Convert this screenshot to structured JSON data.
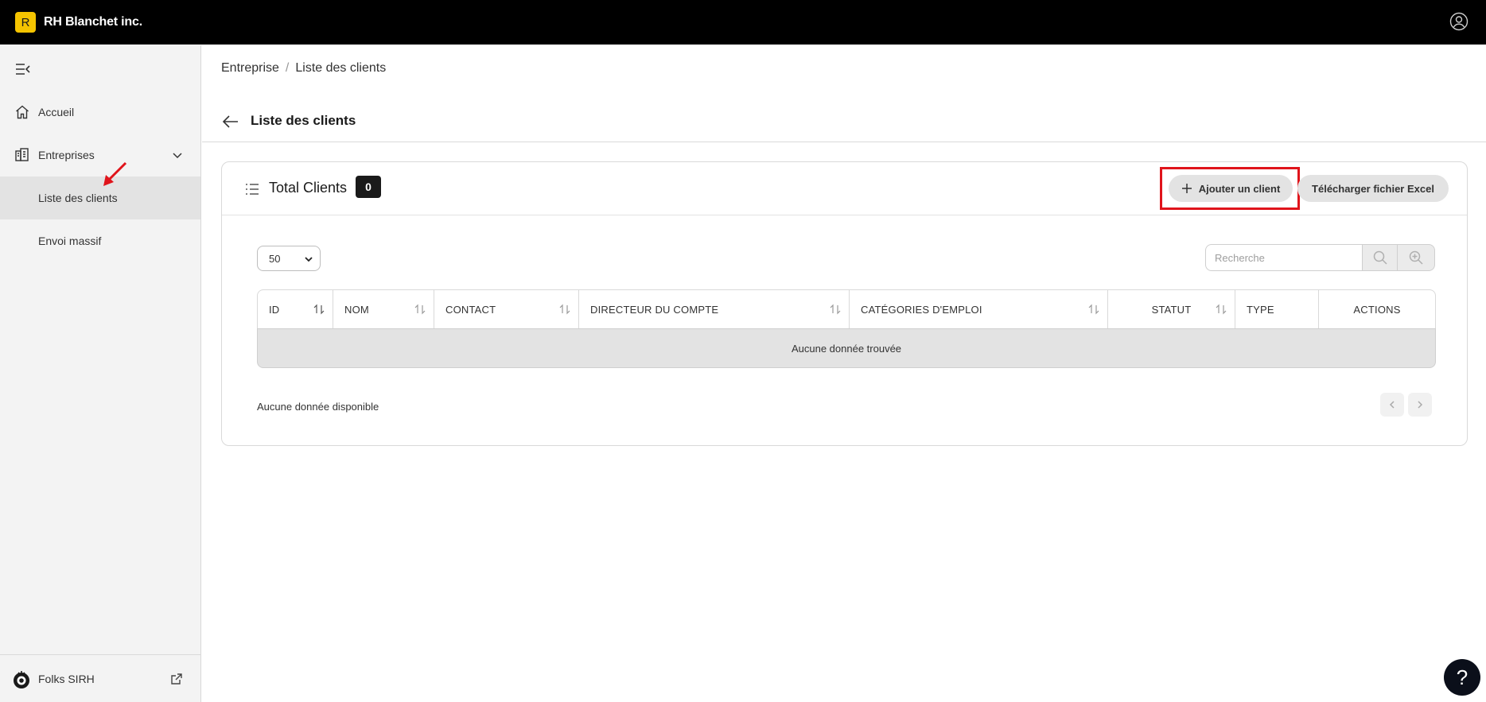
{
  "app": {
    "logo_letter": "R",
    "name": "RH Blanchet inc.",
    "accent": "#f5c400"
  },
  "topbar": {
    "user_icon": "user-circle-icon"
  },
  "sidebar": {
    "collapse_icon": "collapse-menu-icon",
    "items": [
      {
        "label": "Accueil",
        "icon": "home-icon"
      },
      {
        "label": "Entreprises",
        "icon": "building-icon"
      },
      {
        "label": "Liste des clients"
      },
      {
        "label": "Envoi massif"
      }
    ],
    "footer": {
      "label": "Folks SIRH",
      "icon": "folks-logo-icon",
      "link_icon": "external-link-icon"
    }
  },
  "breadcrumb": {
    "items": [
      "Entreprise",
      "Liste des clients"
    ],
    "separator": "/"
  },
  "page": {
    "title": "Liste des clients"
  },
  "card": {
    "title": "Total Clients",
    "count": "0",
    "add_button": "Ajouter un client",
    "excel_button": "Télécharger fichier Excel",
    "highlight_color": "#e0141b"
  },
  "controls": {
    "page_size": "50",
    "search_placeholder": "Recherche"
  },
  "table": {
    "columns": [
      "ID",
      "NOM",
      "CONTACT",
      "DIRECTEUR DU COMPTE",
      "CATÉGORIES D'EMPLOI",
      "STATUT",
      "TYPE",
      "ACTIONS"
    ],
    "empty_message": "Aucune donnée trouvée"
  },
  "footer": {
    "no_data": "Aucune donnée disponible"
  },
  "help": {
    "label": "?"
  }
}
